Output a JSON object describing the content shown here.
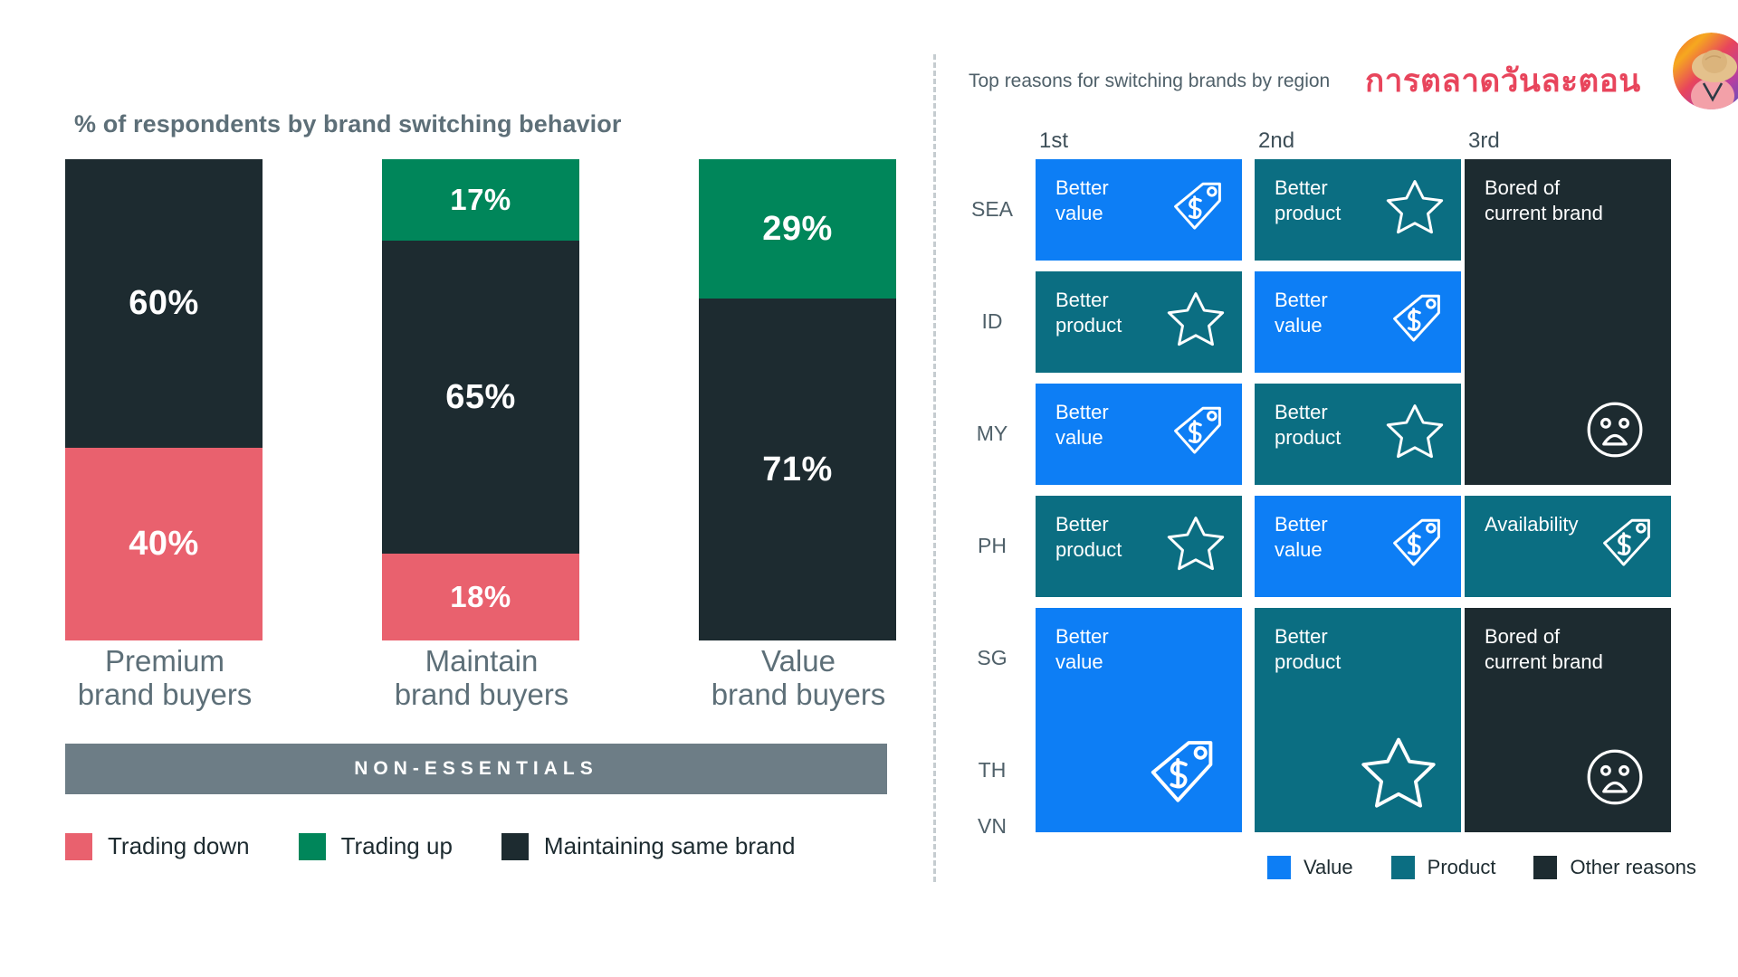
{
  "left": {
    "title": "% of respondents by brand switching behavior",
    "banner_label": "NON-ESSENTIALS",
    "legend": [
      {
        "label": "Trading down",
        "color": "#e9616e"
      },
      {
        "label": "Trading up",
        "color": "#00865a"
      },
      {
        "label": "Maintaining same brand",
        "color": "#1d2b30"
      }
    ]
  },
  "right": {
    "title": "Top reasons for switching brands by region",
    "brand": "การตลาดวันละตอน",
    "column_headers": [
      "1st",
      "2nd",
      "3rd"
    ],
    "row_labels": [
      "SEA",
      "ID",
      "MY",
      "PH",
      "SG",
      "TH",
      "VN"
    ],
    "legend": [
      {
        "label": "Value",
        "color": "#0d7ef5"
      },
      {
        "label": "Product",
        "color": "#0b6e82"
      },
      {
        "label": "Other reasons",
        "color": "#1d2b30"
      }
    ],
    "cells": [
      {
        "row": "SEA",
        "col": "1st",
        "label": "Better\nvalue",
        "category": "Value",
        "icon": "price-tag-icon"
      },
      {
        "row": "SEA",
        "col": "2nd",
        "label": "Better\nproduct",
        "category": "Product",
        "icon": "star-icon"
      },
      {
        "row": "SEA-MY",
        "col": "3rd",
        "label": "Bored of\ncurrent brand",
        "category": "Other reasons",
        "icon": "sad-face-icon"
      },
      {
        "row": "ID",
        "col": "1st",
        "label": "Better\nproduct",
        "category": "Product",
        "icon": "star-icon"
      },
      {
        "row": "ID",
        "col": "2nd",
        "label": "Better\nvalue",
        "category": "Value",
        "icon": "price-tag-icon"
      },
      {
        "row": "MY",
        "col": "1st",
        "label": "Better\nvalue",
        "category": "Value",
        "icon": "price-tag-icon"
      },
      {
        "row": "MY",
        "col": "2nd",
        "label": "Better\nproduct",
        "category": "Product",
        "icon": "star-icon"
      },
      {
        "row": "PH",
        "col": "1st",
        "label": "Better\nproduct",
        "category": "Product",
        "icon": "star-icon"
      },
      {
        "row": "PH",
        "col": "2nd",
        "label": "Better\nvalue",
        "category": "Value",
        "icon": "price-tag-icon"
      },
      {
        "row": "PH",
        "col": "3rd",
        "label": "Availability",
        "category": "Product",
        "icon": "price-tag-icon"
      },
      {
        "row": "SG-VN",
        "col": "1st",
        "label": "Better\nvalue",
        "category": "Value",
        "icon": "price-tag-icon"
      },
      {
        "row": "SG-VN",
        "col": "2nd",
        "label": "Better\nproduct",
        "category": "Product",
        "icon": "star-icon"
      },
      {
        "row": "SG-VN",
        "col": "3rd",
        "label": "Bored of\ncurrent brand",
        "category": "Other reasons",
        "icon": "sad-face-icon"
      }
    ]
  },
  "chart_data": {
    "type": "bar",
    "title": "% of respondents by brand switching behavior",
    "xlabel": "",
    "ylabel": "% of respondents",
    "ylim": [
      0,
      100
    ],
    "grid": false,
    "legend_position": "bottom-left",
    "stacked": true,
    "categories": [
      "Premium\nbrand buyers",
      "Maintain\nbrand buyers",
      "Value\nbrand buyers"
    ],
    "series": [
      {
        "name": "Trading up",
        "color": "#00865a",
        "values": [
          0,
          17,
          29
        ]
      },
      {
        "name": "Maintaining same brand",
        "color": "#1d2b30",
        "values": [
          60,
          65,
          71
        ]
      },
      {
        "name": "Trading down",
        "color": "#e9616e",
        "values": [
          40,
          18,
          0
        ]
      }
    ],
    "bars": [
      {
        "category": "Premium\nbrand buyers",
        "segments": [
          {
            "name": "Maintaining same brand",
            "value": 60,
            "label": "60%",
            "color": "#1d2b30"
          },
          {
            "name": "Trading down",
            "value": 40,
            "label": "40%",
            "color": "#e9616e"
          }
        ]
      },
      {
        "category": "Maintain\nbrand buyers",
        "segments": [
          {
            "name": "Trading up",
            "value": 17,
            "label": "17%",
            "color": "#00865a"
          },
          {
            "name": "Maintaining same brand",
            "value": 65,
            "label": "65%",
            "color": "#1d2b30"
          },
          {
            "name": "Trading down",
            "value": 18,
            "label": "18%",
            "color": "#e9616e"
          }
        ]
      },
      {
        "category": "Value\nbrand buyers",
        "segments": [
          {
            "name": "Trading up",
            "value": 29,
            "label": "29%",
            "color": "#00865a"
          },
          {
            "name": "Maintaining same brand",
            "value": 71,
            "label": "71%",
            "color": "#1d2b30"
          }
        ]
      }
    ]
  }
}
